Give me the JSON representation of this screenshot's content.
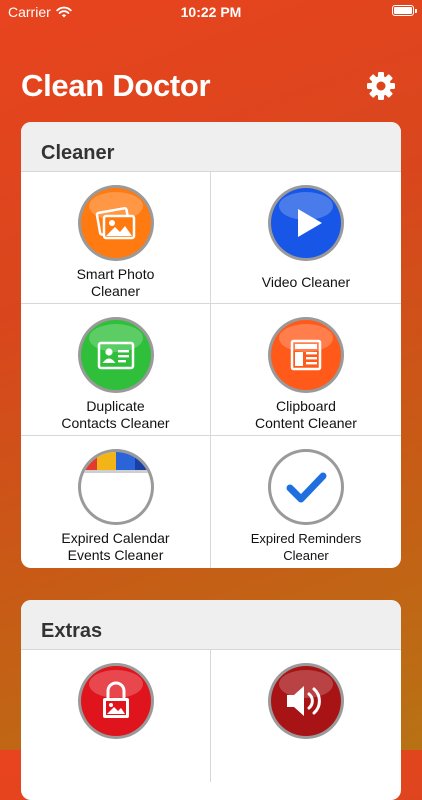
{
  "status_bar": {
    "carrier": "Carrier",
    "time": "10:22 PM"
  },
  "app": {
    "title": "Clean Doctor"
  },
  "cleaner": {
    "header": "Cleaner",
    "items": [
      {
        "label": "Smart Photo\nCleaner",
        "icon": "photo-icon",
        "color": "#ff7a10"
      },
      {
        "label": "Video Cleaner",
        "icon": "play-icon",
        "color": "#1756e6"
      },
      {
        "label": "Duplicate\nContacts Cleaner",
        "icon": "contact-card-icon",
        "color": "#2fbf3a"
      },
      {
        "label": "Clipboard\nContent Cleaner",
        "icon": "clipboard-icon",
        "color": "#ff5a1a"
      },
      {
        "label": "Expired Calendar\nEvents Cleaner",
        "icon": "calendar-icon",
        "color": "#ffffff"
      },
      {
        "label": "Expired Reminders\nCleaner",
        "icon": "checkmark-icon",
        "color": "#ffffff"
      }
    ]
  },
  "extras": {
    "header": "Extras",
    "items": [
      {
        "icon": "locked-photo-icon",
        "color": "#e0141c"
      },
      {
        "icon": "speaker-icon",
        "color": "#a81416"
      }
    ]
  }
}
